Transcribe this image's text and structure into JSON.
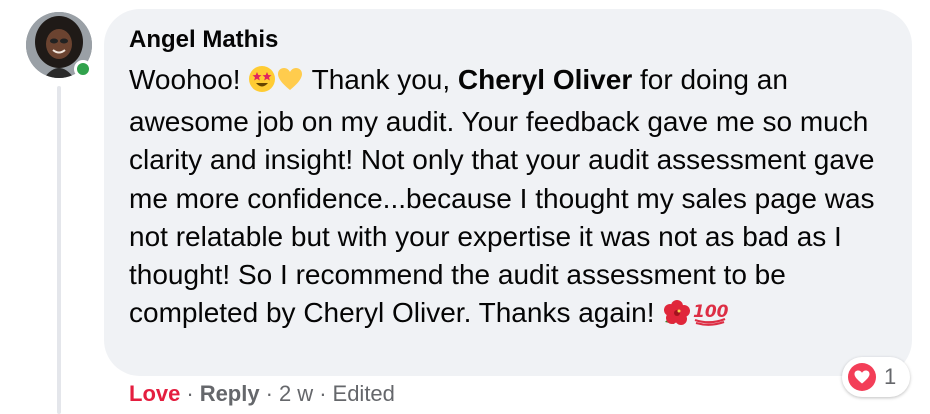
{
  "author": {
    "name": "Angel Mathis",
    "online": true
  },
  "comment": {
    "part1": "Woohoo! ",
    "emoji1": "star-struck",
    "emoji2": "yellow-heart",
    "part2": " Thank you, ",
    "mention": "Cheryl Oliver",
    "part3": " for doing an awesome job on my audit. Your feedback gave me so much clarity and insight! Not only that your audit assessment gave me more confidence...because I thought my sales page was not relatable but with your expertise it was not as bad as I thought! So I recommend the audit assessment to be completed by Cheryl Oliver. Thanks again! ",
    "emoji3": "hibiscus",
    "emoji4": "hundred-points"
  },
  "reactions": {
    "type": "love",
    "count": "1",
    "color": "#f33e58"
  },
  "actions": {
    "love_label": "Love",
    "reply_label": "Reply",
    "time": "2 w",
    "edited": "Edited",
    "separator": "·"
  },
  "colors": {
    "bubble": "#f0f2f5",
    "love": "#e41e3f",
    "meta": "#65676b",
    "online": "#31a24c"
  }
}
